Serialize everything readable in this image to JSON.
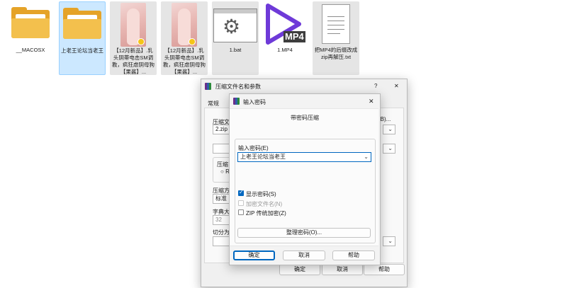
{
  "explorer": {
    "files": [
      {
        "name": "__MACOSX",
        "type": "folder-icon"
      },
      {
        "name": "上老王论坛当老王",
        "type": "folder-icon"
      },
      {
        "name": "【12月新品】.乳头阴蒂电击SM调教，疯狂虐阴母狗【果酱】...",
        "type": "photo-thumbnail"
      },
      {
        "name": "【12月新品】.乳头阴蒂电击SM调教，疯狂虐阴母狗【果酱】...",
        "type": "photo-thumbnail"
      },
      {
        "name": "1.bat",
        "type": "gear-icon"
      },
      {
        "name": "1.MP4",
        "type": "play-icon",
        "badge": "MP4",
        "accent": "#6e3ad8"
      },
      {
        "name": "把MP4的后缀改成zip再解压.txt",
        "type": "text-file-icon"
      }
    ]
  },
  "archive_dialog": {
    "title": "压缩文件名和参数",
    "help_glyph": "?",
    "close_glyph": "✕",
    "tab_general": "常规",
    "filename_label": "压缩文",
    "filename_value": "2.zip",
    "browse_label": "(B)...",
    "update_mode_label": "",
    "format_label": "压缩",
    "format_option": "R",
    "method_label": "压缩方",
    "method_value": "标准",
    "dict_label": "字典大",
    "dict_value": "32",
    "split_label": "切分为",
    "ok_label": "确定",
    "cancel_label": "取消",
    "help_label": "帮助"
  },
  "password_dialog": {
    "title": "输入密码",
    "close_glyph": "✕",
    "heading": "带密码压缩",
    "enter_label": "输入密码(E)",
    "password_value": "上老王论坛当老王",
    "show_password_label": "显示密码(S)",
    "show_password_checked": true,
    "encrypt_names_label": "加密文件名(N)",
    "encrypt_names_checked": false,
    "zip_legacy_label": "ZIP 传统加密(Z)",
    "zip_legacy_checked": false,
    "organize_label": "整理密码(O)...",
    "ok_label": "确定",
    "cancel_label": "取消",
    "help_label": "帮助",
    "accent": "#0067c0"
  }
}
